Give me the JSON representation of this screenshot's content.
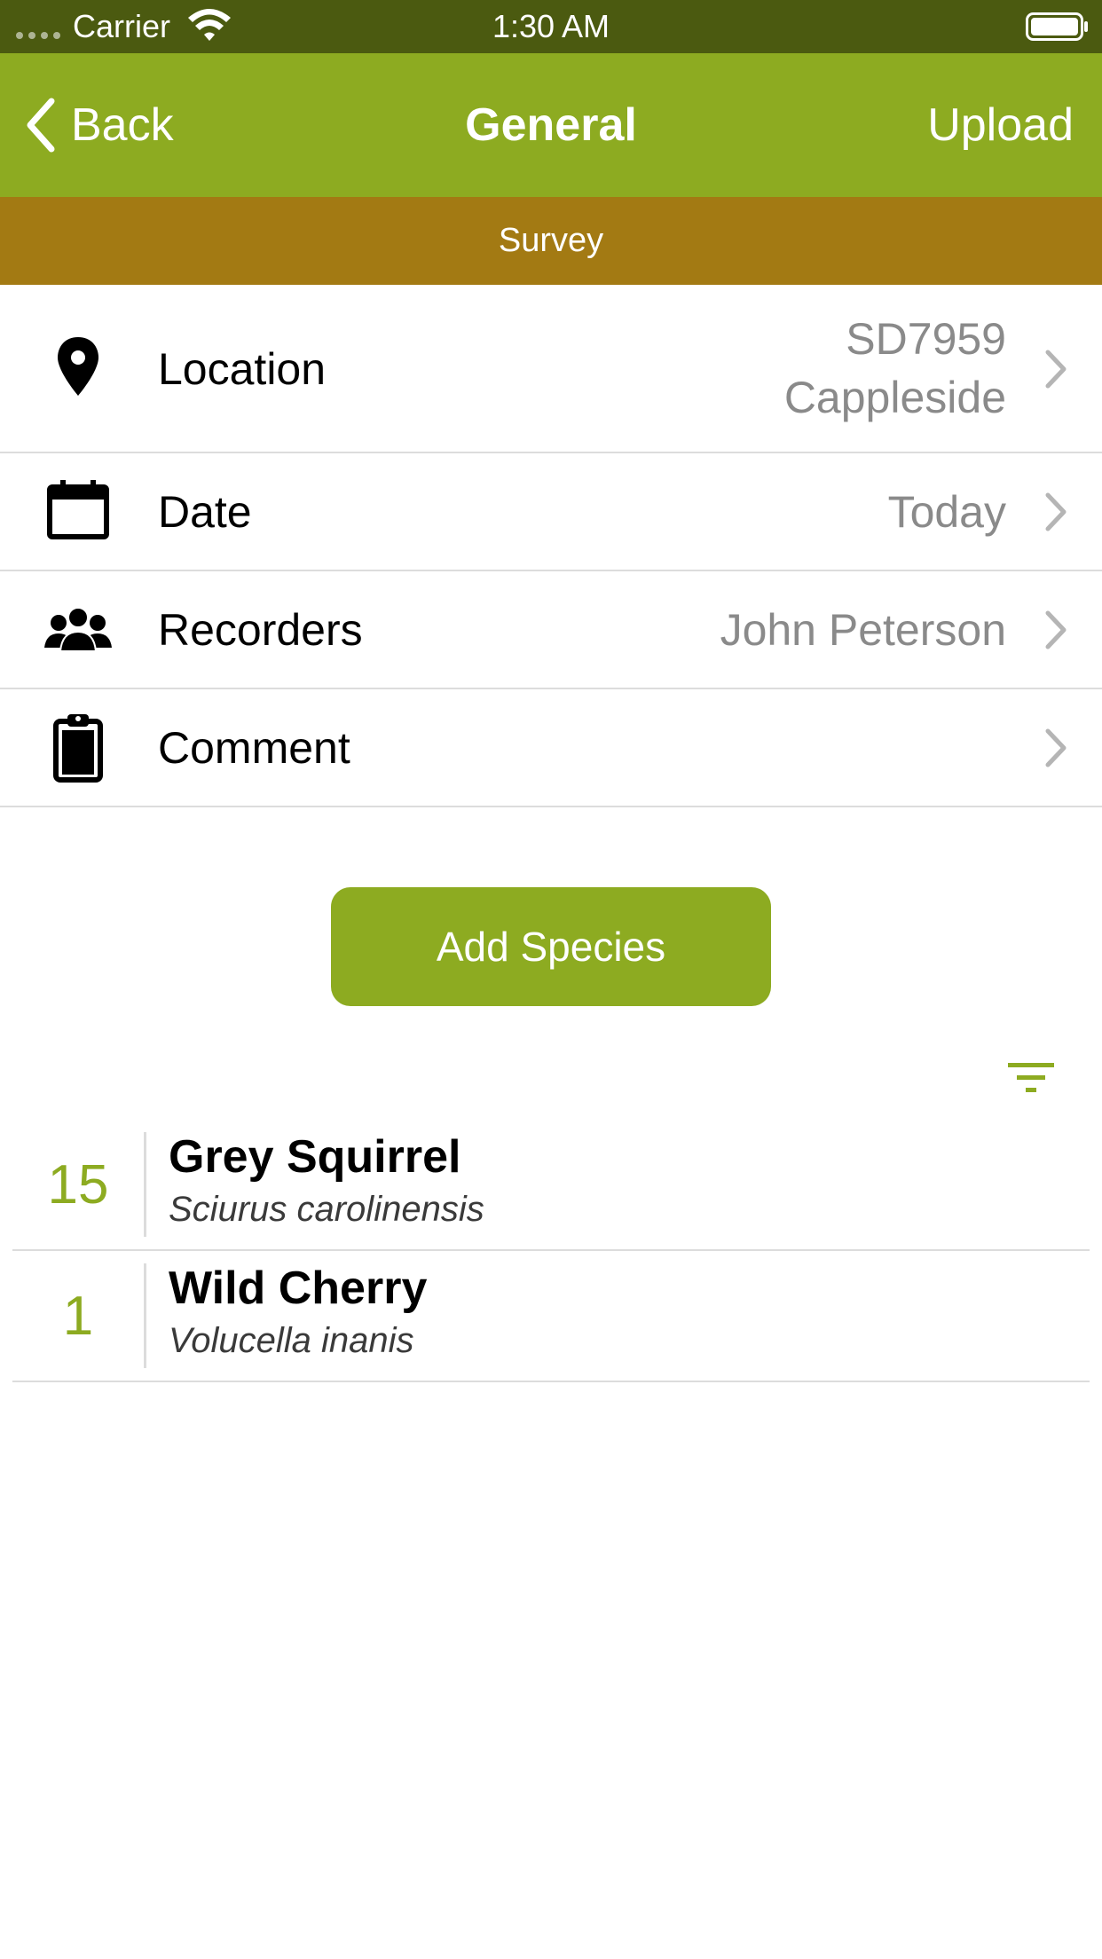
{
  "status_bar": {
    "carrier": "Carrier",
    "time": "1:30 AM"
  },
  "nav": {
    "back_label": "Back",
    "title": "General",
    "upload_label": "Upload",
    "color": "#8dab21"
  },
  "banner": {
    "label": "Survey",
    "color": "#a37a13"
  },
  "rows": [
    {
      "icon": "map-marker-icon",
      "label": "Location",
      "value_line1": "SD7959",
      "value_line2": "Cappleside"
    },
    {
      "icon": "calendar-icon",
      "label": "Date",
      "value": "Today"
    },
    {
      "icon": "people-icon",
      "label": "Recorders",
      "value": "John Peterson"
    },
    {
      "icon": "clipboard-icon",
      "label": "Comment",
      "value": ""
    }
  ],
  "add_species_label": "Add Species",
  "species": [
    {
      "count": "15",
      "common_name": "Grey Squirrel",
      "latin_name": "Sciurus carolinensis"
    },
    {
      "count": "1",
      "common_name": "Wild Cherry",
      "latin_name": "Volucella inanis"
    }
  ]
}
